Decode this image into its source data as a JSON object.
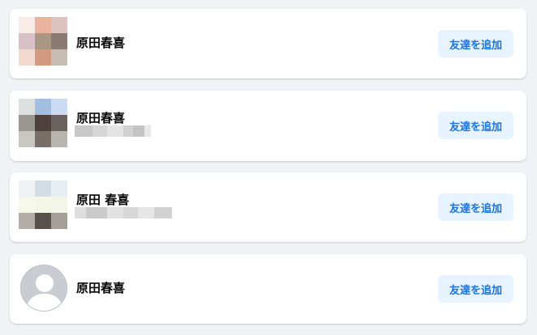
{
  "suggestions": [
    {
      "name": "原田春喜",
      "button_label": "友達を追加",
      "avatar_type": "photo",
      "avatar_pixels": [
        "#f7ece6",
        "#e8b29d",
        "#dcc3c0",
        "#d8c0c7",
        "#a99683",
        "#8a7a72",
        "#f4d9d1",
        "#d29a7f",
        "#c7bdb2"
      ]
    },
    {
      "name": "原田春喜",
      "button_label": "友達を追加",
      "avatar_type": "photo",
      "avatar_pixels": [
        "#dde0e0",
        "#a3bede",
        "#cbdcf2",
        "#9b9590",
        "#4d403d",
        "#6a625e",
        "#cac6c2",
        "#7a6e69",
        "#b8b4af"
      ],
      "subtitle_blurred": true
    },
    {
      "name": "原田 春喜",
      "button_label": "友達を追加",
      "avatar_type": "photo",
      "avatar_pixels": [
        "#eef2f4",
        "#d2dde3",
        "#e8eef1",
        "#f6f8e9",
        "#f5f7e6",
        "#f2f5e8",
        "#b3ada8",
        "#58504d",
        "#a49e99"
      ],
      "subtitle_blurred": true
    },
    {
      "name": "原田春喜",
      "button_label": "友達を追加",
      "avatar_type": "default-profile-icon"
    }
  ]
}
